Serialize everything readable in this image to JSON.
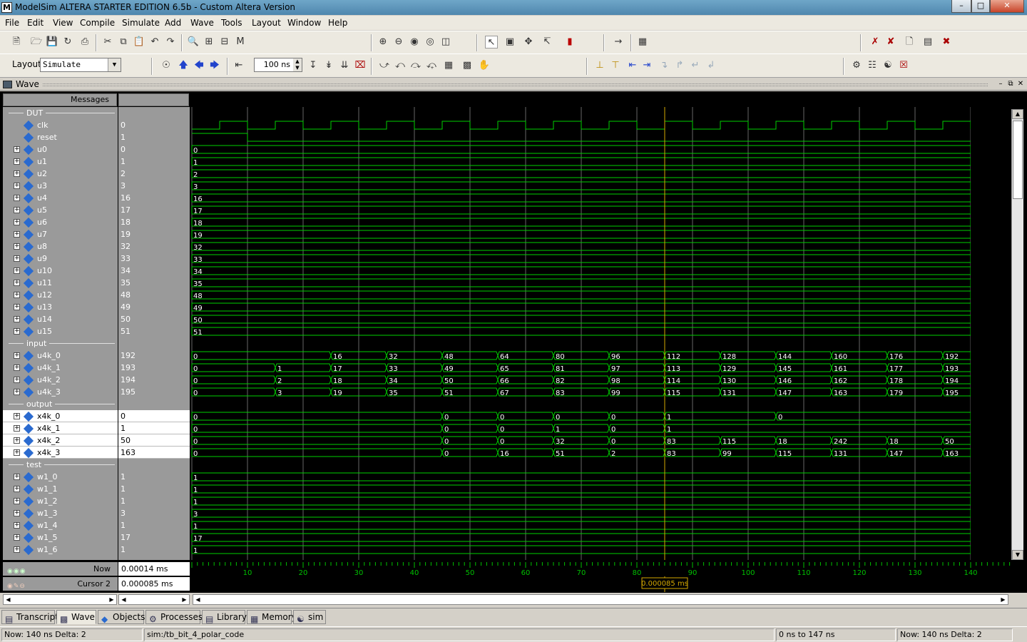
{
  "window": {
    "title": "ModelSim ALTERA STARTER EDITION 6.5b - Custom Altera Version",
    "icon_letter": "M"
  },
  "menu": [
    "File",
    "Edit",
    "View",
    "Compile",
    "Simulate",
    "Add",
    "Wave",
    "Tools",
    "Layout",
    "Window",
    "Help"
  ],
  "toolbar": {
    "layout_label": "Layout",
    "layout_value": "Simulate",
    "run_length": "100 ns"
  },
  "wave": {
    "pane_title": "Wave",
    "messages_header": "Messages",
    "groups": {
      "dut": "DUT",
      "input": "input",
      "output": "output",
      "test": "test"
    },
    "signals": {
      "dut": [
        {
          "name": "clk",
          "value": "0",
          "expandable": false
        },
        {
          "name": "reset",
          "value": "1",
          "expandable": false
        },
        {
          "name": "u0",
          "value": "0",
          "expandable": true
        },
        {
          "name": "u1",
          "value": "1",
          "expandable": true
        },
        {
          "name": "u2",
          "value": "2",
          "expandable": true
        },
        {
          "name": "u3",
          "value": "3",
          "expandable": true
        },
        {
          "name": "u4",
          "value": "16",
          "expandable": true
        },
        {
          "name": "u5",
          "value": "17",
          "expandable": true
        },
        {
          "name": "u6",
          "value": "18",
          "expandable": true
        },
        {
          "name": "u7",
          "value": "19",
          "expandable": true
        },
        {
          "name": "u8",
          "value": "32",
          "expandable": true
        },
        {
          "name": "u9",
          "value": "33",
          "expandable": true
        },
        {
          "name": "u10",
          "value": "34",
          "expandable": true
        },
        {
          "name": "u11",
          "value": "35",
          "expandable": true
        },
        {
          "name": "u12",
          "value": "48",
          "expandable": true
        },
        {
          "name": "u13",
          "value": "49",
          "expandable": true
        },
        {
          "name": "u14",
          "value": "50",
          "expandable": true
        },
        {
          "name": "u15",
          "value": "51",
          "expandable": true
        }
      ],
      "input": [
        {
          "name": "u4k_0",
          "value": "192",
          "expandable": true
        },
        {
          "name": "u4k_1",
          "value": "193",
          "expandable": true
        },
        {
          "name": "u4k_2",
          "value": "194",
          "expandable": true
        },
        {
          "name": "u4k_3",
          "value": "195",
          "expandable": true
        }
      ],
      "output": [
        {
          "name": "x4k_0",
          "value": "0",
          "expandable": true
        },
        {
          "name": "x4k_1",
          "value": "1",
          "expandable": true
        },
        {
          "name": "x4k_2",
          "value": "50",
          "expandable": true
        },
        {
          "name": "x4k_3",
          "value": "163",
          "expandable": true
        }
      ],
      "test": [
        {
          "name": "w1_0",
          "value": "1",
          "expandable": true
        },
        {
          "name": "w1_1",
          "value": "1",
          "expandable": true
        },
        {
          "name": "w1_2",
          "value": "1",
          "expandable": true
        },
        {
          "name": "w1_3",
          "value": "3",
          "expandable": true
        },
        {
          "name": "w1_4",
          "value": "1",
          "expandable": true
        },
        {
          "name": "w1_5",
          "value": "17",
          "expandable": true
        },
        {
          "name": "w1_6",
          "value": "1",
          "expandable": true
        }
      ]
    },
    "time_axis": {
      "unit": "ns",
      "start": 0,
      "end": 140,
      "ticks": [
        10,
        20,
        30,
        40,
        50,
        60,
        70,
        80,
        90,
        100,
        110,
        120,
        130,
        140
      ]
    },
    "clock_period_ns": 10,
    "reset_release_ns": 10,
    "transitions": {
      "u0": [
        [
          0,
          "0"
        ]
      ],
      "u1": [
        [
          0,
          "1"
        ]
      ],
      "u2": [
        [
          0,
          "2"
        ]
      ],
      "u3": [
        [
          0,
          "3"
        ]
      ],
      "u4": [
        [
          0,
          "16"
        ]
      ],
      "u5": [
        [
          0,
          "17"
        ]
      ],
      "u6": [
        [
          0,
          "18"
        ]
      ],
      "u7": [
        [
          0,
          "19"
        ]
      ],
      "u8": [
        [
          0,
          "32"
        ]
      ],
      "u9": [
        [
          0,
          "33"
        ]
      ],
      "u10": [
        [
          0,
          "34"
        ]
      ],
      "u11": [
        [
          0,
          "35"
        ]
      ],
      "u12": [
        [
          0,
          "48"
        ]
      ],
      "u13": [
        [
          0,
          "49"
        ]
      ],
      "u14": [
        [
          0,
          "50"
        ]
      ],
      "u15": [
        [
          0,
          "51"
        ]
      ],
      "u4k_0": [
        [
          0,
          "0"
        ],
        [
          25,
          "16"
        ],
        [
          35,
          "32"
        ],
        [
          45,
          "48"
        ],
        [
          55,
          "64"
        ],
        [
          65,
          "80"
        ],
        [
          75,
          "96"
        ],
        [
          85,
          "112"
        ],
        [
          95,
          "128"
        ],
        [
          105,
          "144"
        ],
        [
          115,
          "160"
        ],
        [
          125,
          "176"
        ],
        [
          135,
          "192"
        ]
      ],
      "u4k_1": [
        [
          0,
          "0"
        ],
        [
          15,
          "1"
        ],
        [
          25,
          "17"
        ],
        [
          35,
          "33"
        ],
        [
          45,
          "49"
        ],
        [
          55,
          "65"
        ],
        [
          65,
          "81"
        ],
        [
          75,
          "97"
        ],
        [
          85,
          "113"
        ],
        [
          95,
          "129"
        ],
        [
          105,
          "145"
        ],
        [
          115,
          "161"
        ],
        [
          125,
          "177"
        ],
        [
          135,
          "193"
        ]
      ],
      "u4k_2": [
        [
          0,
          "0"
        ],
        [
          15,
          "2"
        ],
        [
          25,
          "18"
        ],
        [
          35,
          "34"
        ],
        [
          45,
          "50"
        ],
        [
          55,
          "66"
        ],
        [
          65,
          "82"
        ],
        [
          75,
          "98"
        ],
        [
          85,
          "114"
        ],
        [
          95,
          "130"
        ],
        [
          105,
          "146"
        ],
        [
          115,
          "162"
        ],
        [
          125,
          "178"
        ],
        [
          135,
          "194"
        ]
      ],
      "u4k_3": [
        [
          0,
          "0"
        ],
        [
          15,
          "3"
        ],
        [
          25,
          "19"
        ],
        [
          35,
          "35"
        ],
        [
          45,
          "51"
        ],
        [
          55,
          "67"
        ],
        [
          65,
          "83"
        ],
        [
          75,
          "99"
        ],
        [
          85,
          "115"
        ],
        [
          95,
          "131"
        ],
        [
          105,
          "147"
        ],
        [
          115,
          "163"
        ],
        [
          125,
          "179"
        ],
        [
          135,
          "195"
        ]
      ],
      "x4k_0": [
        [
          0,
          "0"
        ],
        [
          45,
          "0"
        ],
        [
          55,
          "0"
        ],
        [
          65,
          "0"
        ],
        [
          75,
          "0"
        ],
        [
          85,
          "1"
        ],
        [
          105,
          "0"
        ]
      ],
      "x4k_1": [
        [
          0,
          "0"
        ],
        [
          45,
          "0"
        ],
        [
          55,
          "0"
        ],
        [
          65,
          "1"
        ],
        [
          75,
          "0"
        ],
        [
          85,
          "1"
        ]
      ],
      "x4k_2": [
        [
          0,
          "0"
        ],
        [
          45,
          "0"
        ],
        [
          55,
          "0"
        ],
        [
          65,
          "32"
        ],
        [
          75,
          "0"
        ],
        [
          85,
          "83"
        ],
        [
          95,
          "115"
        ],
        [
          105,
          "18"
        ],
        [
          115,
          "242"
        ],
        [
          125,
          "18"
        ],
        [
          135,
          "50"
        ]
      ],
      "x4k_3": [
        [
          0,
          "0"
        ],
        [
          45,
          "0"
        ],
        [
          55,
          "16"
        ],
        [
          65,
          "51"
        ],
        [
          75,
          "2"
        ],
        [
          85,
          "83"
        ],
        [
          95,
          "99"
        ],
        [
          105,
          "115"
        ],
        [
          115,
          "131"
        ],
        [
          125,
          "147"
        ],
        [
          135,
          "163"
        ]
      ],
      "w1_0": [
        [
          0,
          "1"
        ]
      ],
      "w1_1": [
        [
          0,
          "1"
        ]
      ],
      "w1_2": [
        [
          0,
          "1"
        ]
      ],
      "w1_3": [
        [
          0,
          "3"
        ]
      ],
      "w1_4": [
        [
          0,
          "1"
        ]
      ],
      "w1_5": [
        [
          0,
          "17"
        ]
      ],
      "w1_6": [
        [
          0,
          "1"
        ]
      ]
    },
    "now_label": "Now",
    "now_value": "0.00014 ms",
    "cursor_label": "Cursor 2",
    "cursor_value": "0.000085 ms",
    "cursor_time_ns": 85,
    "colors": {
      "wave": "#00d000",
      "cursor": "#d4a800",
      "grid": "#666666",
      "time_text": "#00c000"
    }
  },
  "tabs": [
    "Transcript",
    "Wave",
    "Objects",
    "Processes",
    "Library",
    "Memory",
    "sim"
  ],
  "active_tab": "Wave",
  "status": {
    "left": "Now: 140 ns   Delta: 2",
    "path": "sim:/tb_bit_4_polar_code",
    "range": "0 ns to 147 ns",
    "right": "Now: 140 ns   Delta: 2"
  }
}
